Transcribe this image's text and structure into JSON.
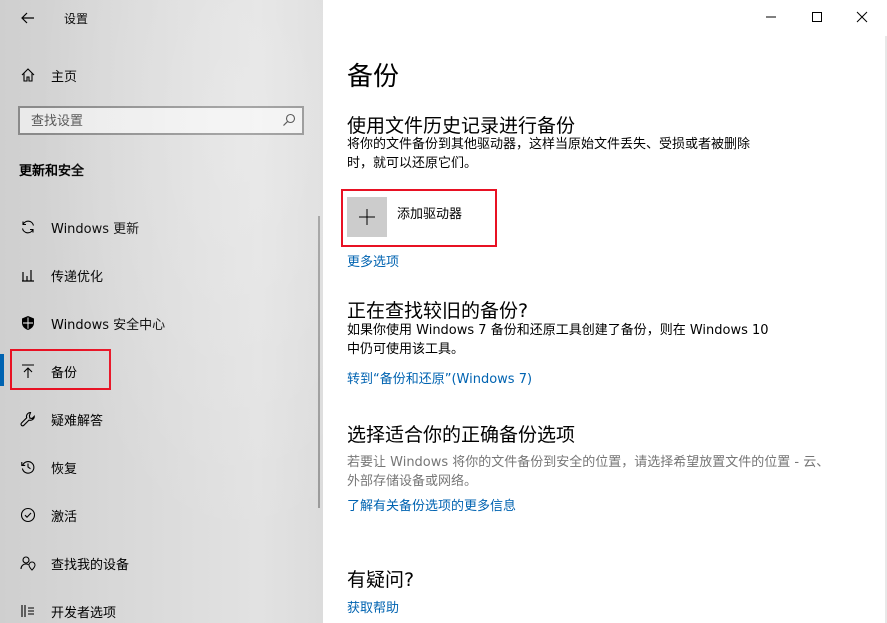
{
  "app": {
    "title": "设置"
  },
  "sidebar": {
    "home_label": "主页",
    "search_placeholder": "查找设置",
    "section_title": "更新和安全",
    "items": [
      {
        "label": "Windows 更新",
        "icon": "sync-icon"
      },
      {
        "label": "传递优化",
        "icon": "delivery-icon"
      },
      {
        "label": "Windows 安全中心",
        "icon": "shield-icon"
      },
      {
        "label": "备份",
        "icon": "upload-icon",
        "active": true
      },
      {
        "label": "疑难解答",
        "icon": "wrench-icon"
      },
      {
        "label": "恢复",
        "icon": "history-icon"
      },
      {
        "label": "激活",
        "icon": "check-circle-icon"
      },
      {
        "label": "查找我的设备",
        "icon": "person-location-icon"
      },
      {
        "label": "开发者选项",
        "icon": "developer-icon"
      }
    ]
  },
  "main": {
    "title": "备份",
    "file_history": {
      "heading": "使用文件历史记录进行备份",
      "description_line1": "将你的文件备份到其他驱动器，这样当原始文件丢失、受损或者被删除",
      "description_line2": "时，就可以还原它们。",
      "add_drive_label": "添加驱动器",
      "more_options": "更多选项"
    },
    "older_backup": {
      "heading": "正在查找较旧的备份?",
      "description_line1": "如果你使用 Windows 7 备份和还原工具创建了备份，则在 Windows 10",
      "description_line2": "中仍可使用该工具。",
      "link": "转到“备份和还原”(Windows 7)"
    },
    "choose": {
      "heading": "选择适合你的正确备份选项",
      "description_line1": "若要让 Windows 将你的文件备份到安全的位置，请选择希望放置文件的位置 - 云、",
      "description_line2": "外部存储设备或网络。",
      "link": "了解有关备份选项的更多信息"
    },
    "help": {
      "heading": "有疑问?",
      "link": "获取帮助"
    }
  },
  "colors": {
    "accent": "#0063b1",
    "highlight_border": "#e81123"
  }
}
